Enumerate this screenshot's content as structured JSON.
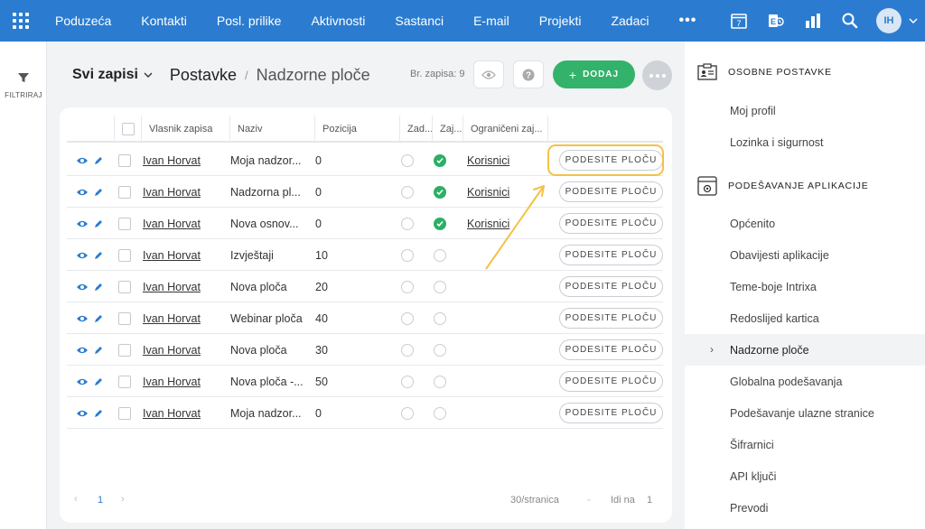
{
  "nav": {
    "items": [
      "Poduzeća",
      "Kontakti",
      "Posl. prilike",
      "Aktivnosti",
      "Sastanci",
      "E-mail",
      "Projekti",
      "Zadaci"
    ],
    "more": "•••",
    "calendar_day": "7",
    "avatar": "IH"
  },
  "filter": {
    "label": "FILTRIRAJ"
  },
  "header": {
    "view": "Svi zapisi",
    "crumb1": "Postavke",
    "crumb2": "Nadzorne ploče",
    "count": "Br. zapisa: 9",
    "add": "DODAJ"
  },
  "table": {
    "columns": [
      "Vlasnik zapisa",
      "Naziv",
      "Pozicija",
      "Zad...",
      "Zaj...",
      "Ograničeni zaj..."
    ],
    "button": "PODESITE PLOČU",
    "rows": [
      {
        "owner": "Ivan Horvat",
        "name": "Moja nadzor...",
        "pos": "0",
        "zad": false,
        "zaj": true,
        "ogr": "Korisnici"
      },
      {
        "owner": "Ivan Horvat",
        "name": "Nadzorna pl...",
        "pos": "0",
        "zad": false,
        "zaj": true,
        "ogr": "Korisnici"
      },
      {
        "owner": "Ivan Horvat",
        "name": "Nova osnov...",
        "pos": "0",
        "zad": false,
        "zaj": true,
        "ogr": "Korisnici"
      },
      {
        "owner": "Ivan Horvat",
        "name": "Izvještaji",
        "pos": "10",
        "zad": false,
        "zaj": false,
        "ogr": ""
      },
      {
        "owner": "Ivan Horvat",
        "name": "Nova ploča",
        "pos": "20",
        "zad": false,
        "zaj": false,
        "ogr": ""
      },
      {
        "owner": "Ivan Horvat",
        "name": "Webinar ploča",
        "pos": "40",
        "zad": false,
        "zaj": false,
        "ogr": ""
      },
      {
        "owner": "Ivan Horvat",
        "name": "Nova ploča",
        "pos": "30",
        "zad": false,
        "zaj": false,
        "ogr": ""
      },
      {
        "owner": "Ivan Horvat",
        "name": "Nova ploča -...",
        "pos": "50",
        "zad": false,
        "zaj": false,
        "ogr": ""
      },
      {
        "owner": "Ivan Horvat",
        "name": "Moja nadzor...",
        "pos": "0",
        "zad": false,
        "zaj": false,
        "ogr": ""
      }
    ]
  },
  "pager": {
    "page": "1",
    "per_page": "30/stranica",
    "goto_label": "Idi na",
    "goto_value": "1"
  },
  "right": {
    "section1": "OSOBNE POSTAVKE",
    "section1_items": [
      "Moj profil",
      "Lozinka i sigurnost"
    ],
    "section2": "PODEŠAVANJE APLIKACIJE",
    "section2_items": [
      "Općenito",
      "Obavijesti aplikacije",
      "Teme-boje Intrixa",
      "Redoslijed kartica",
      "Nadzorne ploče",
      "Globalna podešavanja",
      "Podešavanje ulazne stranice",
      "Šifrarnici",
      "API ključi",
      "Prevodi"
    ]
  },
  "colors": {
    "nav": "#2b7cd0",
    "green": "#33b26b",
    "highlight": "#f3c246",
    "check": "#2bb064"
  }
}
